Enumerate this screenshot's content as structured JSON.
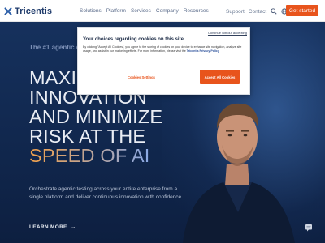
{
  "header": {
    "logo_text": "Tricentis",
    "nav": [
      "Solutions",
      "Platform",
      "Services",
      "Company",
      "Resources"
    ],
    "support_label": "Support",
    "contact_label": "Contact",
    "cta_label": "Get started"
  },
  "hero": {
    "eyebrow": "The #1 agentic quality engineering platform",
    "headline_lines": [
      "MAXIMIZE",
      "INNOVATION",
      "AND MINIMIZE",
      "RISK AT THE"
    ],
    "headline_accent": "SPEED OF AI",
    "subtext": "Orchestrate agentic testing across your entire enterprise from a single platform and deliver continuous innovation with confidence.",
    "learn_more": "LEARN MORE",
    "learn_more_arrow": "→"
  },
  "cookie_modal": {
    "continue_label": "Continue without accepting",
    "title": "Your choices regarding cookies on this site",
    "body": "By clicking \"Accept All Cookies\", you agree to the storing of cookies on your device to enhance site navigation, analyze site usage, and assist in our marketing efforts. For more information, please visit the",
    "privacy_link": "Tricentis Privacy Policy",
    "settings_label": "Cookies Settings",
    "accept_label": "Accept All Cookies"
  },
  "colors": {
    "accent": "#e8541c",
    "hero_bg": "#122a52",
    "logo_blue": "#1f3b6b"
  },
  "icons": [
    "tricentis-logo-icon",
    "search-icon",
    "globe-icon",
    "arrow-right-icon",
    "chat-icon"
  ]
}
